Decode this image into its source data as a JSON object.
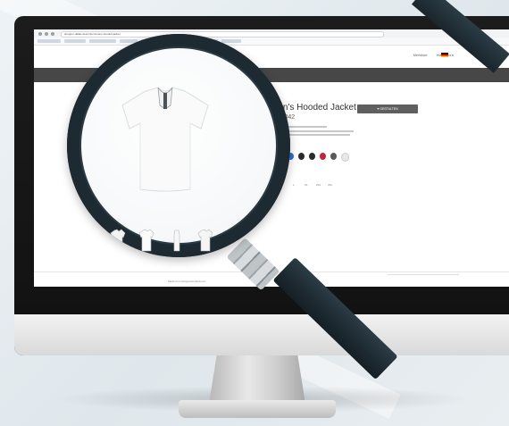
{
  "image": {
    "subject": "magnifying-glass-over-monitor",
    "accent": "#1d2a31",
    "background": "#e6ecef"
  },
  "browser": {
    "url": "shopper-dallas.de/en/item/mens-hooded-jacket",
    "bookmark_count": 8
  },
  "site": {
    "top_links": [
      "Merkliste",
      "Warenkorb"
    ],
    "language_flag": "flag-de-icon",
    "cta_label": "♥ GESTALTEN",
    "product_title": "Men's Hooded Jacket",
    "product_code": "JN1042",
    "size_label": "Größe",
    "sizes": [
      "S",
      "M",
      "L",
      "XL",
      "2XL",
      "3XL"
    ],
    "swatch_colors": [
      "#2d3a8c",
      "#2f6fd1",
      "#2b2b2b",
      "#c8223a",
      "#5a5a5a",
      "#e8e8e8"
    ],
    "footer_text": "Made from shoppersunited.com"
  },
  "lens": {
    "thumbnail_count": 4
  }
}
